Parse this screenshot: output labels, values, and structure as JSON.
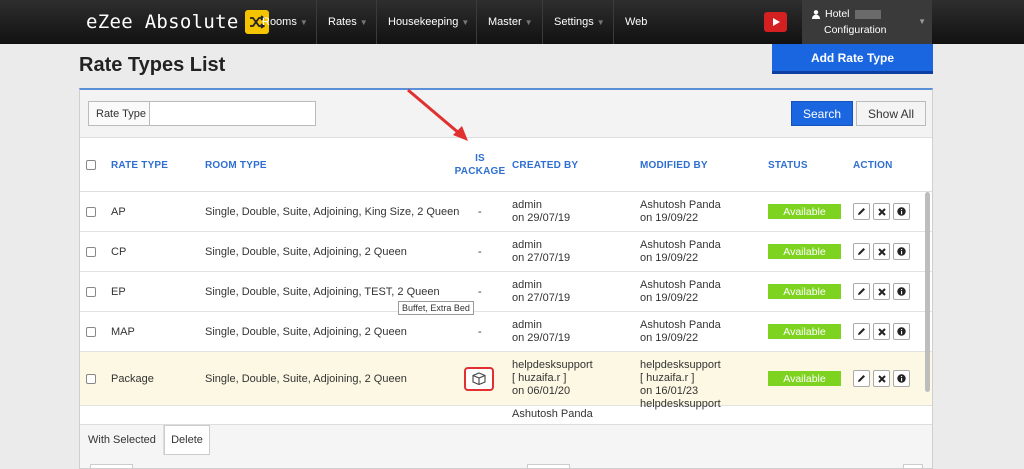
{
  "nav": {
    "logo": "eZee Absolute",
    "items": [
      {
        "label": "Rooms",
        "dropdown": true
      },
      {
        "label": "Rates",
        "dropdown": true
      },
      {
        "label": "Housekeeping",
        "dropdown": true
      },
      {
        "label": "Master",
        "dropdown": true
      },
      {
        "label": "Settings",
        "dropdown": true
      },
      {
        "label": "Web",
        "dropdown": false
      }
    ],
    "hotel_label": "Hotel",
    "configuration_label": "Configuration"
  },
  "page": {
    "title": "Rate Types List",
    "add_button": "Add Rate Type"
  },
  "filter": {
    "rate_type_label": "Rate Type",
    "rate_type_value": "",
    "search_label": "Search",
    "show_all_label": "Show All"
  },
  "table": {
    "headers": {
      "rate_type": "RATE TYPE",
      "room_type": "ROOM TYPE",
      "is_package": "IS PACKAGE",
      "created_by": "CREATED BY",
      "modified_by": "MODIFIED BY",
      "status": "STATUS",
      "action": "ACTION"
    },
    "rows": [
      {
        "rate_type": "AP",
        "room_type": "Single, Double, Suite, Adjoining, King Size, 2 Queen",
        "is_package": "-",
        "created_by": "admin",
        "created_on": "on 29/07/19",
        "modified_by": "Ashutosh Panda",
        "modified_on": "on 19/09/22",
        "status": "Available"
      },
      {
        "rate_type": "CP",
        "room_type": "Single, Double, Suite, Adjoining, 2 Queen",
        "is_package": "-",
        "created_by": "admin",
        "created_on": "on 27/07/19",
        "modified_by": "Ashutosh Panda",
        "modified_on": "on 19/09/22",
        "status": "Available"
      },
      {
        "rate_type": "EP",
        "room_type": "Single, Double, Suite, Adjoining, TEST, 2 Queen",
        "is_package": "-",
        "created_by": "admin",
        "created_on": "on 27/07/19",
        "modified_by": "Ashutosh Panda",
        "modified_on": "on 19/09/22",
        "status": "Available"
      },
      {
        "rate_type": "MAP",
        "room_type": "Single, Double, Suite, Adjoining, 2 Queen",
        "is_package": "-",
        "created_by": "admin",
        "created_on": "on 29/07/19",
        "modified_by": "Ashutosh Panda",
        "modified_on": "on 19/09/22",
        "status": "Available"
      },
      {
        "rate_type": "Package",
        "room_type": "Single, Double, Suite, Adjoining, 2 Queen",
        "is_package": "package-icon",
        "created_by": "helpdesksupport",
        "created_user": "[ huzaifa.r ]",
        "created_on": "on 06/01/20",
        "modified_by": "helpdesksupport",
        "modified_user": "[ huzaifa.r ]",
        "modified_on": "on 16/01/23",
        "status": "Available"
      },
      {
        "rate_type": "",
        "room_type": "",
        "is_package": "",
        "created_by": "Ashutosh Panda",
        "modified_by": "helpdesksupport",
        "status": ""
      }
    ],
    "package_tooltip": "Buffet, Extra Bed"
  },
  "footer": {
    "with_selected_label": "With Selected",
    "delete_label": "Delete"
  },
  "colors": {
    "accent": "#1a66e0",
    "status_available": "#7ed321",
    "header_text": "#2f6fd1",
    "highlight_row": "#fcf8e3",
    "annotation": "#e03030"
  }
}
